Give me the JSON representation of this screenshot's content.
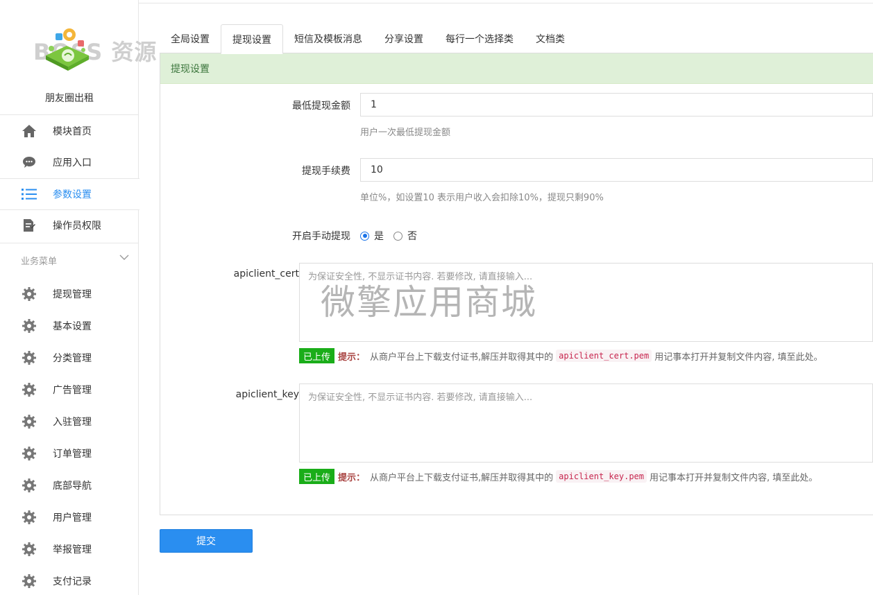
{
  "sidebar": {
    "logo_text": "BOSS 资源",
    "app_name": "朋友圈出租",
    "top_items": [
      {
        "label": "模块首页",
        "icon": "home-icon"
      },
      {
        "label": "应用入口",
        "icon": "chat-bubble-icon"
      },
      {
        "label": "参数设置",
        "icon": "list-icon",
        "active": true
      },
      {
        "label": "操作员权限",
        "icon": "document-edit-icon"
      }
    ],
    "section_title": "业务菜单",
    "biz_items": [
      {
        "label": "提现管理",
        "icon": "gear-icon"
      },
      {
        "label": "基本设置",
        "icon": "gear-icon"
      },
      {
        "label": "分类管理",
        "icon": "gear-icon"
      },
      {
        "label": "广告管理",
        "icon": "gear-icon"
      },
      {
        "label": "入驻管理",
        "icon": "gear-icon"
      },
      {
        "label": "订单管理",
        "icon": "gear-icon"
      },
      {
        "label": "底部导航",
        "icon": "gear-icon"
      },
      {
        "label": "用户管理",
        "icon": "gear-icon"
      },
      {
        "label": "举报管理",
        "icon": "gear-icon"
      },
      {
        "label": "支付记录",
        "icon": "gear-icon"
      }
    ]
  },
  "tabs": [
    {
      "label": "全局设置"
    },
    {
      "label": "提现设置",
      "active": true
    },
    {
      "label": "短信及模板消息"
    },
    {
      "label": "分享设置"
    },
    {
      "label": "每行一个选择类"
    },
    {
      "label": "文档类"
    }
  ],
  "panel": {
    "title": "提现设置",
    "min_amount": {
      "label": "最低提现金额",
      "value": "1",
      "help": "用户一次最低提现金额"
    },
    "fee": {
      "label": "提现手续费",
      "value": "10",
      "help": "单位%，如设置10 表示用户收入会扣除10%，提现只剩90%"
    },
    "manual": {
      "label": "开启手动提现",
      "yes": "是",
      "no": "否",
      "selected": "是"
    },
    "cert": {
      "label": "apiclient_cert",
      "placeholder": "为保证安全性, 不显示证书内容. 若要修改, 请直接输入...",
      "badge": "已上传",
      "tip_label": "提示：",
      "tip_before": "从商户平台上下载支付证书,解压并取得其中的",
      "file": "apiclient_cert.pem",
      "tip_after": "用记事本打开并复制文件内容, 填至此处。"
    },
    "key": {
      "label": "apiclient_key",
      "placeholder": "为保证安全性, 不显示证书内容. 若要修改, 请直接输入...",
      "badge": "已上传",
      "tip_label": "提示：",
      "tip_before": "从商户平台上下载支付证书,解压并取得其中的",
      "file": "apiclient_key.pem",
      "tip_after": "用记事本打开并复制文件内容, 填至此处。"
    }
  },
  "watermark": "微擎应用商城",
  "submit_label": "提交",
  "colors": {
    "accent": "#2a8ef0",
    "panel_head_bg": "#dff0d8",
    "badge": "#1aad19",
    "tip": "#a94442"
  }
}
